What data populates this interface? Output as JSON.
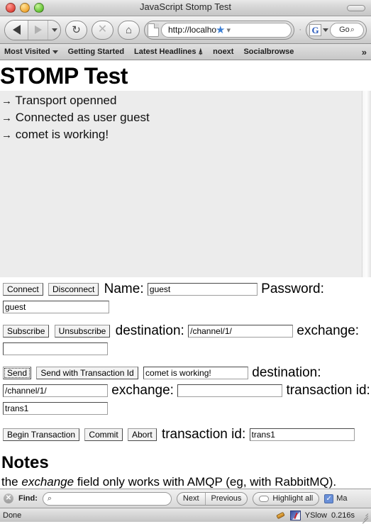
{
  "window": {
    "title": "JavaScript Stomp Test"
  },
  "toolbar": {
    "back_icon": "back-arrow-icon",
    "forward_icon": "forward-arrow-icon",
    "dropdown_icon": "chevron-down-icon",
    "reload_icon": "reload-icon",
    "reload_glyph": "↻",
    "stop_icon": "stop-icon",
    "stop_glyph": "✕",
    "home_icon": "home-icon",
    "home_glyph": "⌂",
    "url": "http://localho",
    "star_glyph": "★",
    "url_dropdown_glyph": "▾",
    "separator_dot": "·",
    "search_engine": "G",
    "search_placeholder": "Go",
    "search_glyph": "⌕"
  },
  "bookmarks": {
    "items": [
      {
        "label": "Most Visited",
        "has_caret": true
      },
      {
        "label": "Getting Started",
        "has_caret": false
      },
      {
        "label": "Latest Headlines ⍋",
        "has_caret": false
      },
      {
        "label": "noext",
        "has_caret": false
      },
      {
        "label": "Socialbrowse",
        "has_caret": false
      }
    ],
    "overflow_glyph": "»"
  },
  "page": {
    "heading": "STOMP Test",
    "log": [
      {
        "arrow": "→",
        "text": "Transport openned"
      },
      {
        "arrow": "→",
        "text": "Connected as user guest"
      },
      {
        "arrow": "→",
        "text": "comet is working!"
      }
    ],
    "connect_row": {
      "connect_label": "Connect",
      "disconnect_label": "Disconnect",
      "name_label": "Name:",
      "name_value": "guest",
      "password_label": "Password:",
      "password_value": "guest"
    },
    "subscribe_row": {
      "subscribe_label": "Subscribe",
      "unsubscribe_label": "Unsubscribe",
      "destination_label": "destination:",
      "destination_value": "/channel/1/",
      "exchange_label": "exchange:",
      "exchange_value": ""
    },
    "send_row": {
      "send_label": "Send",
      "send_tx_label": "Send with Transaction Id",
      "message_value": "comet is working!",
      "destination_label": "destination:",
      "destination_value": "/channel/1/",
      "exchange_label": "exchange:",
      "exchange_value": "",
      "transaction_label": "transaction id:",
      "transaction_value": "trans1"
    },
    "transaction_row": {
      "begin_label": "Begin Transaction",
      "commit_label": "Commit",
      "abort_label": "Abort",
      "transaction_label": "transaction id:",
      "transaction_value": "trans1"
    },
    "notes_heading": "Notes",
    "notes_prefix": "the ",
    "notes_em": "exchange",
    "notes_suffix": " field only works with AMQP (eg, with RabbitMQ)."
  },
  "findbar": {
    "close_glyph": "✕",
    "label": "Find:",
    "input_value": "",
    "search_icon_glyph": "⌕",
    "next_label": "Next",
    "previous_label": "Previous",
    "highlight_all_label": "Highlight all",
    "match_case_label": "Ma",
    "match_case_checked": "✓"
  },
  "statusbar": {
    "status": "Done",
    "firebug_icon": "firebug-bug-icon",
    "yslow_icon": "yslow-icon",
    "yslow_label": "YSlow",
    "load_time": "0.216s"
  }
}
